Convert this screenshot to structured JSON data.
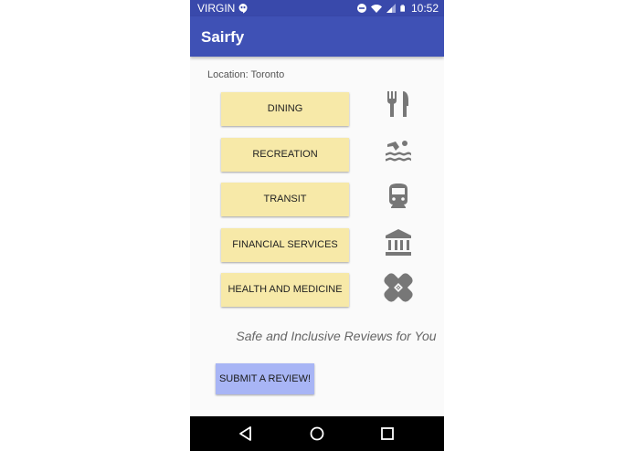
{
  "status_bar": {
    "carrier": "VIRGIN",
    "time": "10:52"
  },
  "app_bar": {
    "title": "Sairfy"
  },
  "location": {
    "label": "Location: Toronto"
  },
  "categories": [
    {
      "label": "DINING",
      "icon": "fork-knife-icon"
    },
    {
      "label": "RECREATION",
      "icon": "swimming-icon"
    },
    {
      "label": "TRANSIT",
      "icon": "train-icon"
    },
    {
      "label": "FINANCIAL SERVICES",
      "icon": "bank-icon"
    },
    {
      "label": "HEALTH AND MEDICINE",
      "icon": "bandage-icon"
    }
  ],
  "tagline": "Safe and Inclusive Reviews for You",
  "submit": {
    "label": "SUBMIT A REVIEW!"
  },
  "colors": {
    "status_bar": "#3949ab",
    "app_bar": "#3f51b5",
    "category_button": "#f7e9a8",
    "submit_button": "#a8b5f5",
    "icon": "#777777"
  }
}
